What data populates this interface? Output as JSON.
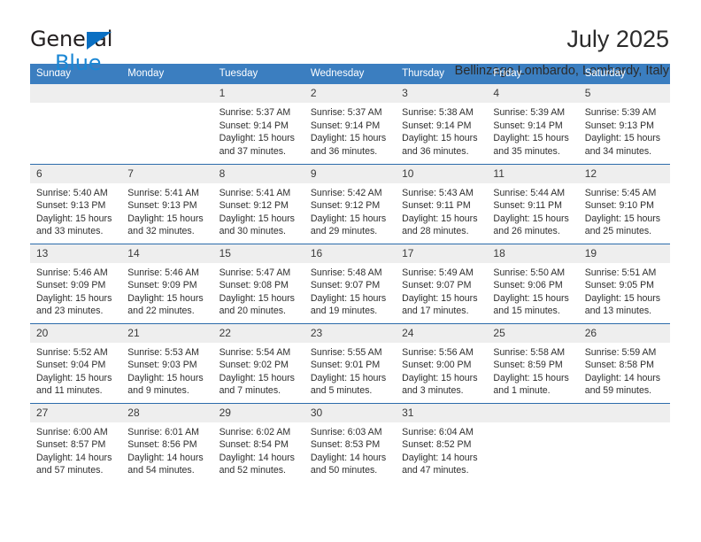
{
  "brand": {
    "line1": "General",
    "line2": "Blue",
    "triangle_color": "#0a6fc2",
    "line2_color": "#1b87d4"
  },
  "header": {
    "title": "July 2025",
    "subtitle": "Bellinzago Lombardo, Lombardy, Italy"
  },
  "theme": {
    "header_bg": "#3b7ec0",
    "row_divider": "#2c6cab",
    "daynum_bg": "#eeeeee"
  },
  "calendar": {
    "weekday_headers": [
      "Sunday",
      "Monday",
      "Tuesday",
      "Wednesday",
      "Thursday",
      "Friday",
      "Saturday"
    ],
    "labels": {
      "sunrise": "Sunrise:",
      "sunset": "Sunset:",
      "daylight": "Daylight:"
    },
    "weeks": [
      [
        {
          "day": "",
          "empty": true
        },
        {
          "day": "",
          "empty": true
        },
        {
          "day": "1",
          "sunrise": "Sunrise: 5:37 AM",
          "sunset": "Sunset: 9:14 PM",
          "daylight_1": "Daylight: 15 hours",
          "daylight_2": "and 37 minutes."
        },
        {
          "day": "2",
          "sunrise": "Sunrise: 5:37 AM",
          "sunset": "Sunset: 9:14 PM",
          "daylight_1": "Daylight: 15 hours",
          "daylight_2": "and 36 minutes."
        },
        {
          "day": "3",
          "sunrise": "Sunrise: 5:38 AM",
          "sunset": "Sunset: 9:14 PM",
          "daylight_1": "Daylight: 15 hours",
          "daylight_2": "and 36 minutes."
        },
        {
          "day": "4",
          "sunrise": "Sunrise: 5:39 AM",
          "sunset": "Sunset: 9:14 PM",
          "daylight_1": "Daylight: 15 hours",
          "daylight_2": "and 35 minutes."
        },
        {
          "day": "5",
          "sunrise": "Sunrise: 5:39 AM",
          "sunset": "Sunset: 9:13 PM",
          "daylight_1": "Daylight: 15 hours",
          "daylight_2": "and 34 minutes."
        }
      ],
      [
        {
          "day": "6",
          "sunrise": "Sunrise: 5:40 AM",
          "sunset": "Sunset: 9:13 PM",
          "daylight_1": "Daylight: 15 hours",
          "daylight_2": "and 33 minutes."
        },
        {
          "day": "7",
          "sunrise": "Sunrise: 5:41 AM",
          "sunset": "Sunset: 9:13 PM",
          "daylight_1": "Daylight: 15 hours",
          "daylight_2": "and 32 minutes."
        },
        {
          "day": "8",
          "sunrise": "Sunrise: 5:41 AM",
          "sunset": "Sunset: 9:12 PM",
          "daylight_1": "Daylight: 15 hours",
          "daylight_2": "and 30 minutes."
        },
        {
          "day": "9",
          "sunrise": "Sunrise: 5:42 AM",
          "sunset": "Sunset: 9:12 PM",
          "daylight_1": "Daylight: 15 hours",
          "daylight_2": "and 29 minutes."
        },
        {
          "day": "10",
          "sunrise": "Sunrise: 5:43 AM",
          "sunset": "Sunset: 9:11 PM",
          "daylight_1": "Daylight: 15 hours",
          "daylight_2": "and 28 minutes."
        },
        {
          "day": "11",
          "sunrise": "Sunrise: 5:44 AM",
          "sunset": "Sunset: 9:11 PM",
          "daylight_1": "Daylight: 15 hours",
          "daylight_2": "and 26 minutes."
        },
        {
          "day": "12",
          "sunrise": "Sunrise: 5:45 AM",
          "sunset": "Sunset: 9:10 PM",
          "daylight_1": "Daylight: 15 hours",
          "daylight_2": "and 25 minutes."
        }
      ],
      [
        {
          "day": "13",
          "sunrise": "Sunrise: 5:46 AM",
          "sunset": "Sunset: 9:09 PM",
          "daylight_1": "Daylight: 15 hours",
          "daylight_2": "and 23 minutes."
        },
        {
          "day": "14",
          "sunrise": "Sunrise: 5:46 AM",
          "sunset": "Sunset: 9:09 PM",
          "daylight_1": "Daylight: 15 hours",
          "daylight_2": "and 22 minutes."
        },
        {
          "day": "15",
          "sunrise": "Sunrise: 5:47 AM",
          "sunset": "Sunset: 9:08 PM",
          "daylight_1": "Daylight: 15 hours",
          "daylight_2": "and 20 minutes."
        },
        {
          "day": "16",
          "sunrise": "Sunrise: 5:48 AM",
          "sunset": "Sunset: 9:07 PM",
          "daylight_1": "Daylight: 15 hours",
          "daylight_2": "and 19 minutes."
        },
        {
          "day": "17",
          "sunrise": "Sunrise: 5:49 AM",
          "sunset": "Sunset: 9:07 PM",
          "daylight_1": "Daylight: 15 hours",
          "daylight_2": "and 17 minutes."
        },
        {
          "day": "18",
          "sunrise": "Sunrise: 5:50 AM",
          "sunset": "Sunset: 9:06 PM",
          "daylight_1": "Daylight: 15 hours",
          "daylight_2": "and 15 minutes."
        },
        {
          "day": "19",
          "sunrise": "Sunrise: 5:51 AM",
          "sunset": "Sunset: 9:05 PM",
          "daylight_1": "Daylight: 15 hours",
          "daylight_2": "and 13 minutes."
        }
      ],
      [
        {
          "day": "20",
          "sunrise": "Sunrise: 5:52 AM",
          "sunset": "Sunset: 9:04 PM",
          "daylight_1": "Daylight: 15 hours",
          "daylight_2": "and 11 minutes."
        },
        {
          "day": "21",
          "sunrise": "Sunrise: 5:53 AM",
          "sunset": "Sunset: 9:03 PM",
          "daylight_1": "Daylight: 15 hours",
          "daylight_2": "and 9 minutes."
        },
        {
          "day": "22",
          "sunrise": "Sunrise: 5:54 AM",
          "sunset": "Sunset: 9:02 PM",
          "daylight_1": "Daylight: 15 hours",
          "daylight_2": "and 7 minutes."
        },
        {
          "day": "23",
          "sunrise": "Sunrise: 5:55 AM",
          "sunset": "Sunset: 9:01 PM",
          "daylight_1": "Daylight: 15 hours",
          "daylight_2": "and 5 minutes."
        },
        {
          "day": "24",
          "sunrise": "Sunrise: 5:56 AM",
          "sunset": "Sunset: 9:00 PM",
          "daylight_1": "Daylight: 15 hours",
          "daylight_2": "and 3 minutes."
        },
        {
          "day": "25",
          "sunrise": "Sunrise: 5:58 AM",
          "sunset": "Sunset: 8:59 PM",
          "daylight_1": "Daylight: 15 hours",
          "daylight_2": "and 1 minute."
        },
        {
          "day": "26",
          "sunrise": "Sunrise: 5:59 AM",
          "sunset": "Sunset: 8:58 PM",
          "daylight_1": "Daylight: 14 hours",
          "daylight_2": "and 59 minutes."
        }
      ],
      [
        {
          "day": "27",
          "sunrise": "Sunrise: 6:00 AM",
          "sunset": "Sunset: 8:57 PM",
          "daylight_1": "Daylight: 14 hours",
          "daylight_2": "and 57 minutes."
        },
        {
          "day": "28",
          "sunrise": "Sunrise: 6:01 AM",
          "sunset": "Sunset: 8:56 PM",
          "daylight_1": "Daylight: 14 hours",
          "daylight_2": "and 54 minutes."
        },
        {
          "day": "29",
          "sunrise": "Sunrise: 6:02 AM",
          "sunset": "Sunset: 8:54 PM",
          "daylight_1": "Daylight: 14 hours",
          "daylight_2": "and 52 minutes."
        },
        {
          "day": "30",
          "sunrise": "Sunrise: 6:03 AM",
          "sunset": "Sunset: 8:53 PM",
          "daylight_1": "Daylight: 14 hours",
          "daylight_2": "and 50 minutes."
        },
        {
          "day": "31",
          "sunrise": "Sunrise: 6:04 AM",
          "sunset": "Sunset: 8:52 PM",
          "daylight_1": "Daylight: 14 hours",
          "daylight_2": "and 47 minutes."
        },
        {
          "day": "",
          "empty": true
        },
        {
          "day": "",
          "empty": true
        }
      ]
    ]
  }
}
